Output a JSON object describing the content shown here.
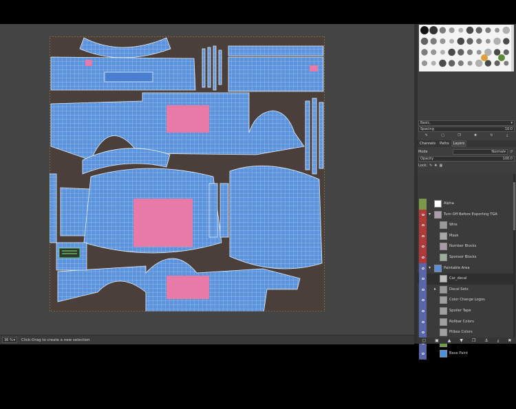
{
  "statusbar": {
    "zoom": "36 %",
    "message": "Click-Drag to create a new selection"
  },
  "brushes": {
    "preset": "Basic,",
    "spacing_label": "Spacing",
    "spacing_value": "10.0"
  },
  "dock_tabs": [
    {
      "label": "Channels"
    },
    {
      "label": "Paths"
    },
    {
      "label": "Layers"
    }
  ],
  "layers_panel": {
    "mode_label": "Mode",
    "mode_value": "Normal",
    "opacity_label": "Opacity",
    "opacity_value": "100.0",
    "lock_label": "Lock:",
    "items": [
      {
        "name": "Alpha",
        "indent": 0,
        "thumb": "#ffffff",
        "eye_color": "#7a9a4a",
        "group": false
      },
      {
        "name": "Turn Off Before Exporting TGA",
        "indent": 0,
        "thumb": "#b09ab0",
        "eye_color": "#b03a3a",
        "group": true
      },
      {
        "name": "Wire",
        "indent": 1,
        "thumb": "#9a9a9a",
        "eye_color": "#b03a3a",
        "group": false
      },
      {
        "name": "Mask",
        "indent": 1,
        "thumb": "#a8a8a8",
        "eye_color": "#b03a3a",
        "group": false
      },
      {
        "name": "Number Blocks",
        "indent": 1,
        "thumb": "#a89aa8",
        "eye_color": "#b03a3a",
        "group": false
      },
      {
        "name": "Sponsor Blocks",
        "indent": 1,
        "thumb": "#9ab09a",
        "eye_color": "#b03a3a",
        "group": false
      },
      {
        "name": "Paintable Area",
        "indent": 0,
        "thumb": "#5a8fd8",
        "eye_color": "#5a64a8",
        "group": true
      },
      {
        "name": "Car_decal",
        "indent": 1,
        "thumb": "#bdbdbd",
        "eye_color": "#5a64a8",
        "group": false
      },
      {
        "name": "Decal Sets",
        "indent": 1,
        "thumb": "#9a9a9a",
        "eye_color": "#5a64a8",
        "group": true
      },
      {
        "name": "Color Change Logos",
        "indent": 1,
        "thumb": "#a0a0a0",
        "eye_color": "#5a64a8",
        "group": false
      },
      {
        "name": "Spoiler Tape",
        "indent": 1,
        "thumb": "#a0a0a0",
        "eye_color": "#5a64a8",
        "group": false
      },
      {
        "name": "Rollbar Colors",
        "indent": 1,
        "thumb": "#a0a0a0",
        "eye_color": "#5a64a8",
        "group": false
      },
      {
        "name": "Pitbox Colors",
        "indent": 1,
        "thumb": "#a0a0a0",
        "eye_color": "#5a64a8",
        "group": false
      },
      {
        "name": "Car Patterns",
        "indent": 1,
        "thumb": "#6aa040",
        "eye_color": "#5a64a8",
        "group": true
      },
      {
        "name": "Base Paint",
        "indent": 1,
        "thumb": "#4a90e2",
        "eye_color": "#5a64a8",
        "group": false
      }
    ]
  },
  "colors": {
    "uv_blue": "#5b93dc",
    "uv_pink": "#e87aa8",
    "canvas_bg": "#4a3f3a",
    "workspace": "#444444"
  }
}
